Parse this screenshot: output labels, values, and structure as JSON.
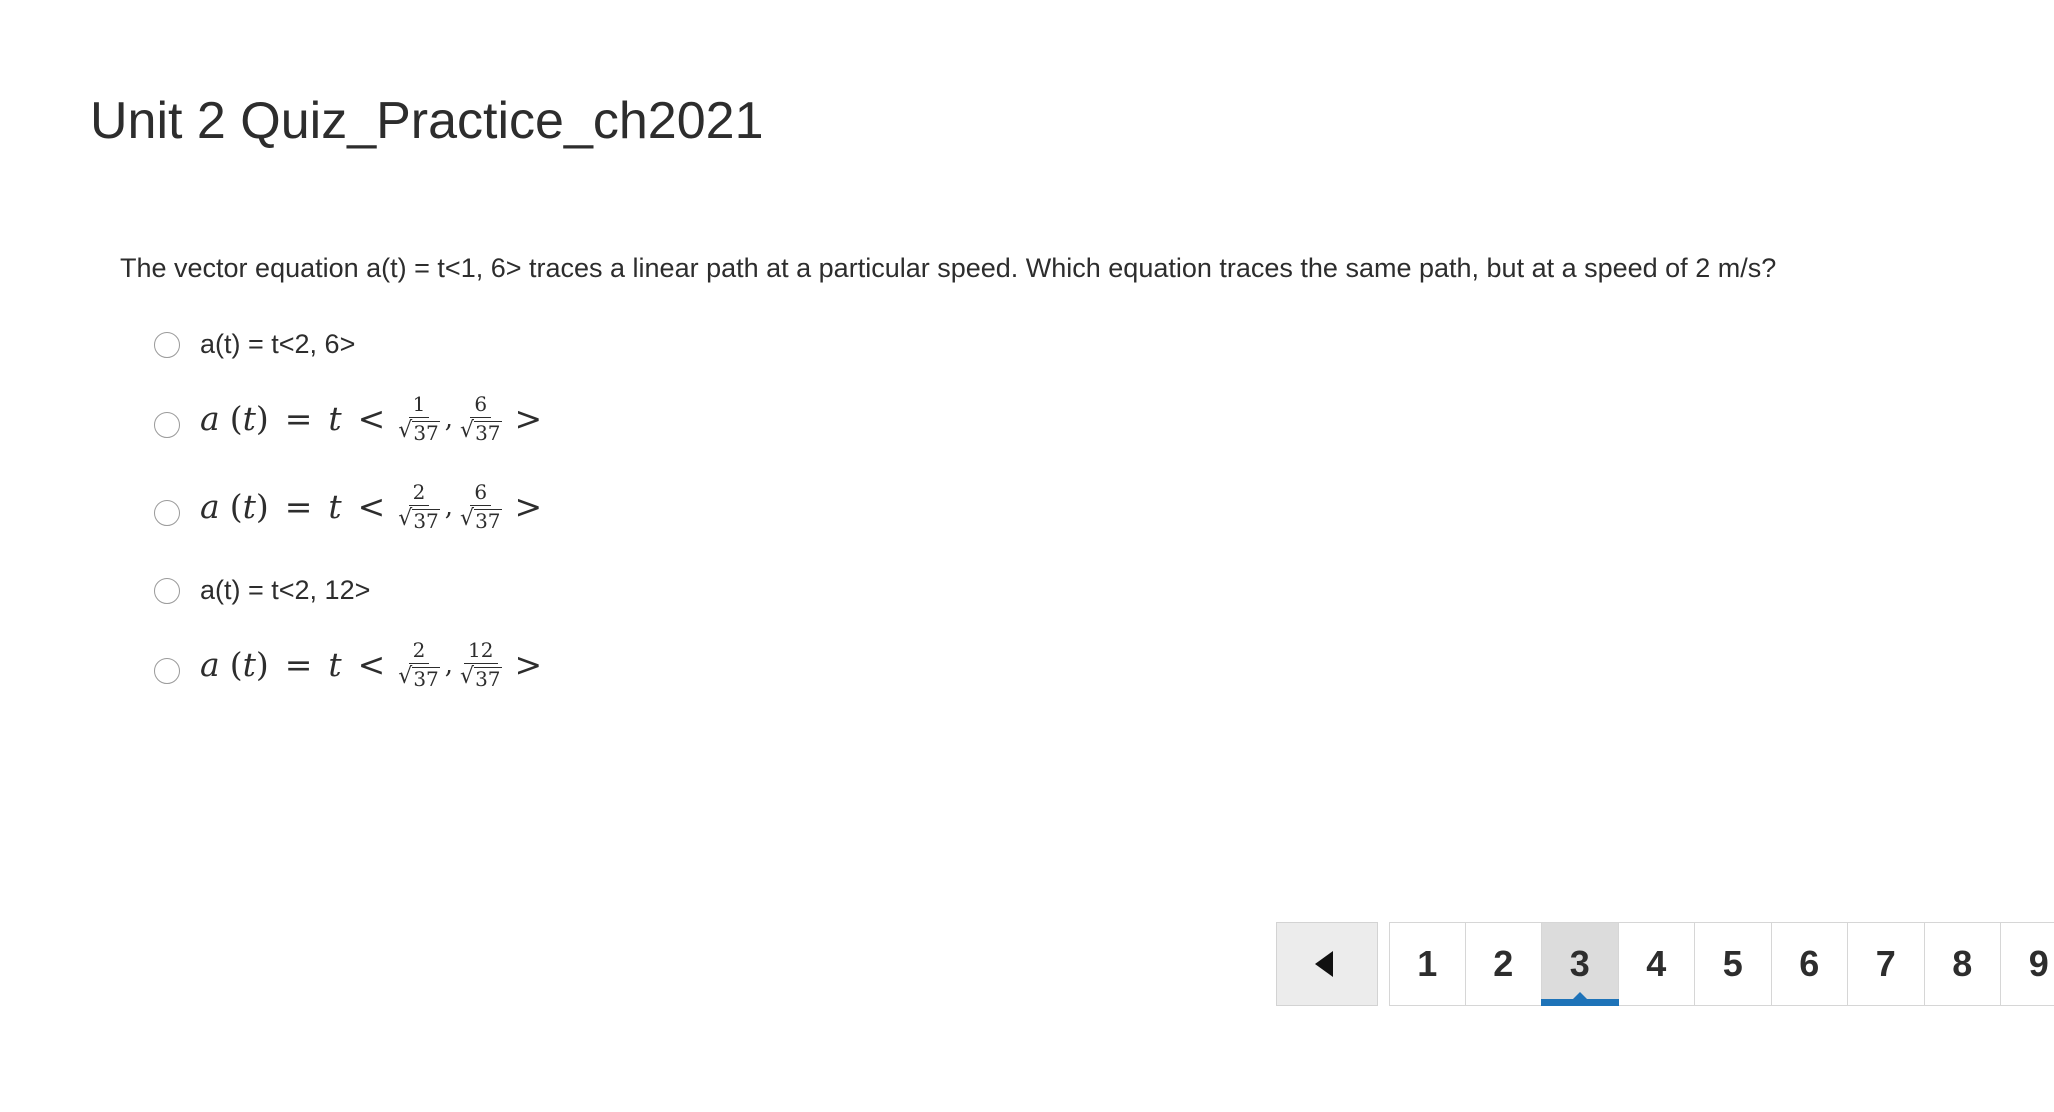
{
  "quiz": {
    "title": "Unit 2 Quiz_Practice_ch2021"
  },
  "question": {
    "text": "The vector equation a(t) = t<1, 6> traces a linear path at a particular speed.  Which equation traces the same path, but at a speed of 2 m/s?",
    "options": [
      {
        "type": "text",
        "label": "a(t) = t<2, 6>"
      },
      {
        "type": "math",
        "lhs_a": "a",
        "lhs_t": "t",
        "coef": "t",
        "num1": "1",
        "den1": "37",
        "num2": "6",
        "den2": "37"
      },
      {
        "type": "math",
        "lhs_a": "a",
        "lhs_t": "t",
        "coef": "t",
        "num1": "2",
        "den1": "37",
        "num2": "6",
        "den2": "37"
      },
      {
        "type": "text",
        "label": "a(t) = t<2, 12>"
      },
      {
        "type": "math",
        "lhs_a": "a",
        "lhs_t": "t",
        "coef": "t",
        "num1": "2",
        "den1": "37",
        "num2": "12",
        "den2": "37"
      }
    ]
  },
  "pagination": {
    "prev_icon": "triangle-left-icon",
    "pages": [
      "1",
      "2",
      "3",
      "4",
      "5",
      "6",
      "7",
      "8",
      "9"
    ],
    "current_page": "3",
    "accent_color": "#1e73b8"
  }
}
